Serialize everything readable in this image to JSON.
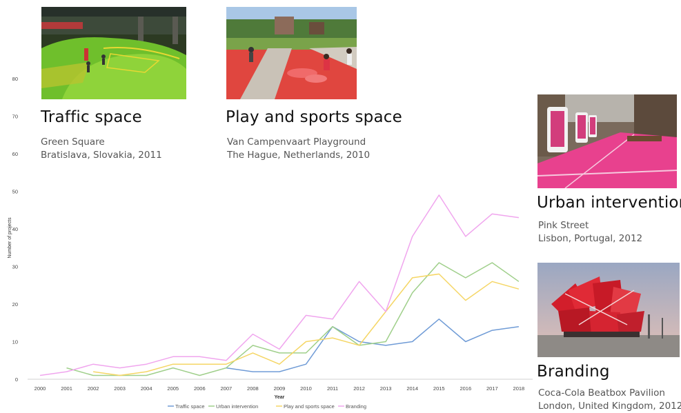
{
  "chart_data": {
    "type": "line",
    "xlabel": "Year",
    "ylabel": "Number of projects",
    "x": [
      2000,
      2001,
      2002,
      2003,
      2004,
      2005,
      2006,
      2007,
      2008,
      2009,
      2010,
      2011,
      2012,
      2013,
      2014,
      2015,
      2016,
      2017,
      2018
    ],
    "ylim": [
      0,
      80
    ],
    "yticks": [
      0,
      10,
      20,
      30,
      40,
      50,
      60,
      70,
      80
    ],
    "grid": false,
    "legend_position": "bottom",
    "series": [
      {
        "name": "Traffic space",
        "color": "#6f9bd6",
        "values": [
          null,
          null,
          null,
          null,
          null,
          null,
          null,
          3,
          2,
          2,
          4,
          14,
          10,
          9,
          10,
          16,
          10,
          13,
          14
        ]
      },
      {
        "name": "Urban intervention",
        "color": "#9fcf8a",
        "values": [
          null,
          3,
          1,
          1,
          1,
          3,
          1,
          3,
          9,
          7,
          7,
          14,
          9,
          10,
          23,
          31,
          27,
          31,
          26
        ]
      },
      {
        "name": "Play and sports space",
        "color": "#f5d665",
        "values": [
          null,
          null,
          2,
          1,
          2,
          4,
          4,
          4,
          7,
          4,
          10,
          11,
          9,
          18,
          27,
          28,
          21,
          26,
          24
        ]
      },
      {
        "name": "Branding",
        "color": "#f0a5ee",
        "values": [
          1,
          2,
          4,
          3,
          4,
          6,
          6,
          5,
          12,
          8,
          17,
          16,
          26,
          18,
          38,
          49,
          38,
          44,
          43
        ]
      }
    ]
  },
  "captions": {
    "traffic": {
      "title": "Traffic space",
      "line1": "Green Square",
      "line2": "Bratislava, Slovakia, 2011"
    },
    "play": {
      "title": "Play and sports space",
      "line1": "Van Campenvaart Playground",
      "line2": "The Hague, Netherlands, 2010"
    },
    "urban": {
      "title": "Urban intervention",
      "line1": "Pink Street",
      "line2": "Lisbon, Portugal, 2012"
    },
    "branding": {
      "title": "Branding",
      "line1": "Coca-Cola Beatbox Pavilion",
      "line2": "London, United Kingdom, 2012"
    }
  }
}
